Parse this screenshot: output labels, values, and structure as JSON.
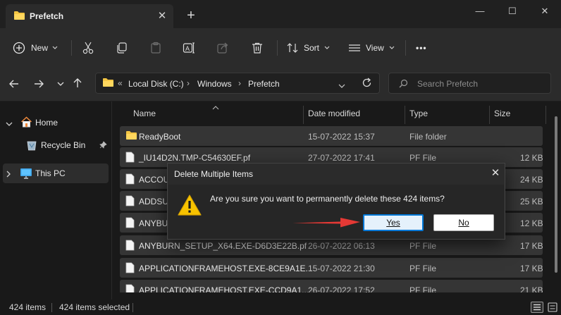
{
  "tab": {
    "title": "Prefetch",
    "close": "✕",
    "new": "+"
  },
  "window_controls": {
    "minimize": "—",
    "maximize": "☐",
    "close": "✕"
  },
  "toolbar": {
    "new_label": "New",
    "sort_label": "Sort",
    "view_label": "View",
    "more_label": "•••"
  },
  "address": {
    "overflow": "«",
    "crumbs": [
      "Local Disk (C:)",
      "Windows",
      "Prefetch"
    ],
    "separator": "›",
    "search_placeholder": "Search Prefetch"
  },
  "sidebar": {
    "items": [
      {
        "label": "Home",
        "icon": "home-icon"
      },
      {
        "label": "Recycle Bin",
        "icon": "recycle-bin-icon",
        "pinned": true
      },
      {
        "label": "This PC",
        "icon": "computer-icon",
        "selected": true
      }
    ]
  },
  "file_list": {
    "columns": [
      "Name",
      "Date modified",
      "Type",
      "Size"
    ],
    "rows": [
      {
        "name": "ReadyBoot",
        "date": "15-07-2022 15:37",
        "type": "File folder",
        "size": "",
        "icon": "folder-icon"
      },
      {
        "name": "_IU14D2N.TMP-C54630EF.pf",
        "date": "27-07-2022 17:41",
        "type": "PF File",
        "size": "12 KB",
        "icon": "file-icon"
      },
      {
        "name": "ACCOU",
        "date": "",
        "type": "",
        "size": "24 KB",
        "icon": "file-icon"
      },
      {
        "name": "ADDSU",
        "date": "",
        "type": "",
        "size": "25 KB",
        "icon": "file-icon"
      },
      {
        "name": "ANYBU",
        "date": "",
        "type": "",
        "size": "12 KB",
        "icon": "file-icon"
      },
      {
        "name": "ANYBURN_SETUP_X64.EXE-D6D3E22B.pf",
        "date": "26-07-2022 06:13",
        "type": "PF File",
        "size": "17 KB",
        "icon": "file-icon"
      },
      {
        "name": "APPLICATIONFRAMEHOST.EXE-8CE9A1E...",
        "date": "15-07-2022 21:30",
        "type": "PF File",
        "size": "17 KB",
        "icon": "file-icon"
      },
      {
        "name": "APPLICATIONFRAMEHOST.EXE-CCD9A1...",
        "date": "26-07-2022 17:52",
        "type": "PF File",
        "size": "21 KB",
        "icon": "file-icon"
      }
    ]
  },
  "status": {
    "count": "424 items",
    "selected": "424 items selected"
  },
  "dialog": {
    "title": "Delete Multiple Items",
    "message": "Are you sure you want to permanently delete these 424 items?",
    "yes_label": "Yes",
    "no_label": "No",
    "close": "✕",
    "icon": "warning-icon"
  },
  "colors": {
    "accent": "#0078d7",
    "arrow": "#e53935",
    "folder": "#f4c542"
  }
}
